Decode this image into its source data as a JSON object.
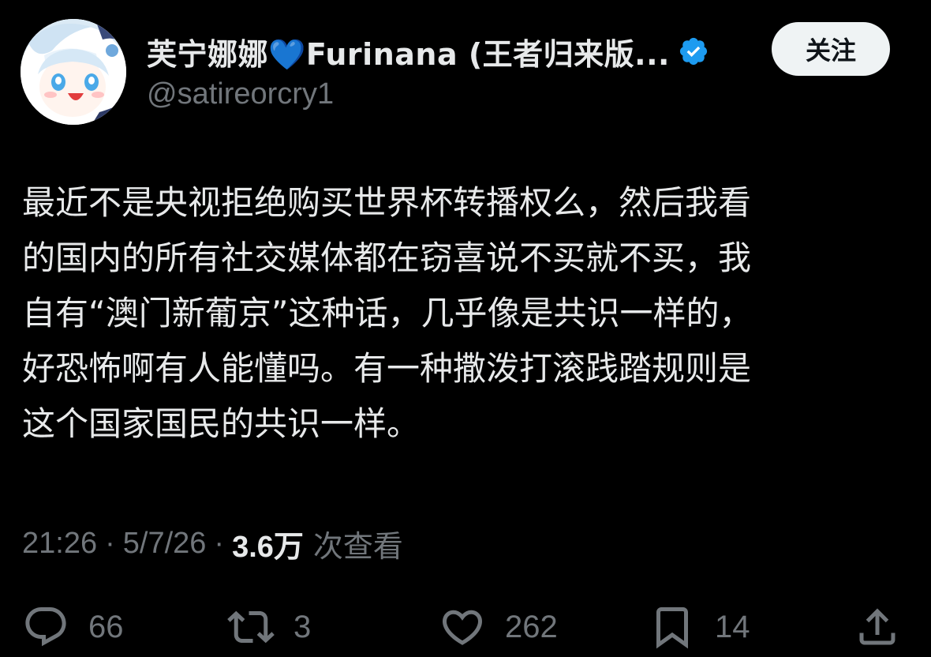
{
  "author": {
    "display_name": "芙宁娜娜💙Furinana (王者归来版...",
    "handle": "@satireorcry1",
    "verified_badge": "verified-check-icon",
    "verified_color": "#1d9bf0"
  },
  "follow_button": {
    "label": "关注"
  },
  "tweet": {
    "lines": [
      "最近不是央视拒绝购买世界杯转播权么，然后我看",
      "的国内的所有社交媒体都在窃喜说不买就不买，我",
      "自有“澳门新葡京”这种话，几乎像是共识一样的，",
      "好恐怖啊有人能懂吗。有一种撒泼打滚践踏规则是",
      "这个国家国民的共识一样。"
    ]
  },
  "meta": {
    "time": "21:26",
    "separator": "·",
    "date": "5/7/26",
    "views_count": "3.6万",
    "views_label": "次查看"
  },
  "actions": {
    "reply": {
      "icon": "reply-icon",
      "count": "66"
    },
    "retweet": {
      "icon": "retweet-icon",
      "count": "3"
    },
    "like": {
      "icon": "heart-icon",
      "count": "262"
    },
    "bookmark": {
      "icon": "bookmark-icon",
      "count": "14"
    },
    "share": {
      "icon": "share-icon"
    }
  },
  "colors": {
    "background": "#000000",
    "text_primary": "#e7e9ea",
    "text_secondary": "#71767b",
    "follow_button_bg": "#eff3f4",
    "follow_button_text": "#0f1419"
  }
}
